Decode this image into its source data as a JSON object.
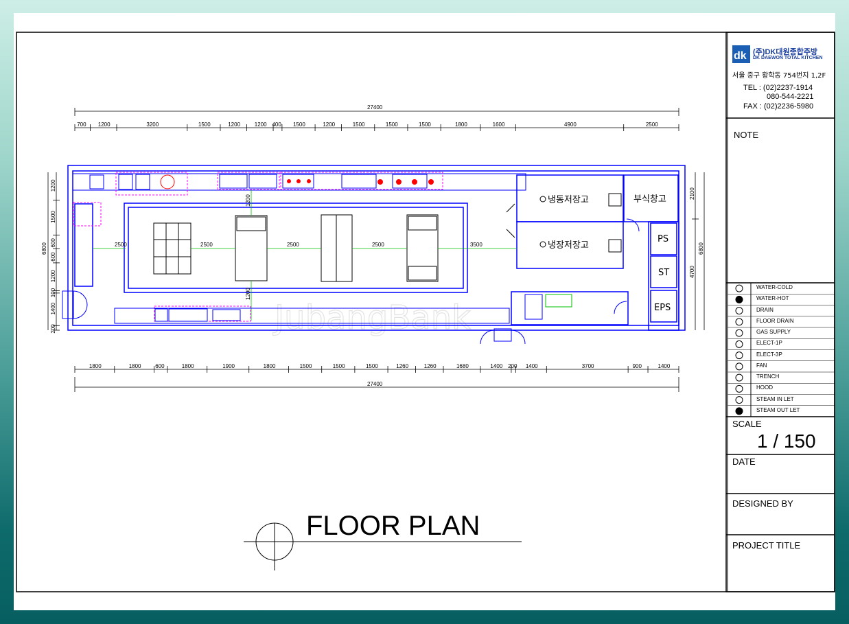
{
  "company": {
    "logo_text": "dk",
    "name_kr": "(주)DK대원종합주방",
    "name_en": "DK DAEWON TOTAL KITCHEN",
    "address": "서울 중구 황학동 754번지 1,2F",
    "tel_label": "TEL : (02)2237-1914",
    "tel_alt": "080-544-2221",
    "fax_label": "FAX : (02)2236-5980"
  },
  "title_block": {
    "note_label": "NOTE",
    "scale_label": "SCALE",
    "scale_value": "1 / 150",
    "date_label": "DATE",
    "designed_by_label": "DESIGNED BY",
    "project_title_label": "PROJECT TITLE"
  },
  "legend": [
    {
      "icon": "water-cold-icon",
      "label": "WATER-COLD"
    },
    {
      "icon": "water-hot-icon",
      "label": "WATER-HOT"
    },
    {
      "icon": "drain-icon",
      "label": "DRAIN"
    },
    {
      "icon": "floor-drain-icon",
      "label": "FLOOR DRAIN"
    },
    {
      "icon": "gas-supply-icon",
      "label": "GAS SUPPLY"
    },
    {
      "icon": "elect-1p-icon",
      "label": "ELECT-1P"
    },
    {
      "icon": "elect-3p-icon",
      "label": "ELECT-3P"
    },
    {
      "icon": "fan-icon",
      "label": "FAN"
    },
    {
      "icon": "trench-icon",
      "label": "TRENCH"
    },
    {
      "icon": "hood-icon",
      "label": "HOOD"
    },
    {
      "icon": "steam-inlet-icon",
      "label": "STEAM IN LET"
    },
    {
      "icon": "steam-outlet-icon",
      "label": "STEAM OUT LET"
    }
  ],
  "drawing": {
    "title": "FLOOR PLAN",
    "watermark": "JubangBank",
    "overall_top": "27400",
    "overall_bottom": "27400",
    "top_dims": [
      "700",
      "1200",
      "3200",
      "1500",
      "1200",
      "1200",
      "400",
      "1500",
      "1200",
      "1500",
      "1500",
      "1500",
      "1800",
      "1600",
      "4900",
      "2500"
    ],
    "bottom_dims": [
      "1800",
      "1800",
      "600",
      "1800",
      "1900",
      "1800",
      "1500",
      "1500",
      "1500",
      "1260",
      "1260",
      "1680",
      "1400",
      "200",
      "1400",
      "3700",
      "900",
      "1400"
    ],
    "left_overall": "6800",
    "left_dims": [
      "1200",
      "1500",
      "600",
      "600",
      "1200",
      "100",
      "1400",
      "200"
    ],
    "right_overall": "6800",
    "right_dims": [
      "2100",
      "4700"
    ],
    "aisle_dims": [
      "2500",
      "2500",
      "2500",
      "2500",
      "3500"
    ],
    "vertical_aisle_dims": [
      "1200",
      "1200"
    ],
    "rooms": {
      "freezer": "냉동저장고",
      "fridge": "냉장저장고",
      "dry_storage": "부식창고",
      "ps": "PS",
      "st": "ST",
      "eps": "EPS"
    }
  },
  "colors": {
    "wall": "#0000ff",
    "dim_green": "#00c000",
    "hood_magenta": "#ff00ff",
    "burner_red": "#ff0000",
    "background_teal": "#0e6b6b"
  }
}
